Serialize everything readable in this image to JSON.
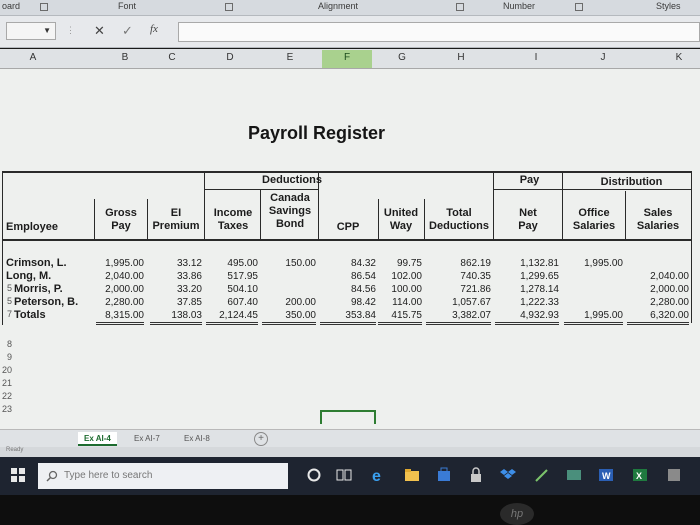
{
  "ribbon": {
    "clipboard_label": "oard",
    "font_label": "Font",
    "alignment_label": "Alignment",
    "number_label": "Number",
    "styles_label": "Styles"
  },
  "formula_bar": {
    "cancel_symbol": "✕",
    "enter_symbol": "✓",
    "fx_symbol": "fx",
    "formula_value": ""
  },
  "column_headers": [
    "A",
    "B",
    "C",
    "D",
    "E",
    "F",
    "G",
    "H",
    "I",
    "J",
    "K"
  ],
  "selected_column": "F",
  "row_numbers": [
    "8",
    "9",
    "20",
    "21",
    "22",
    "23"
  ],
  "sheet": {
    "title": "Payroll Register",
    "group_headers": {
      "deductions": "Deductions",
      "pay": "Pay",
      "distribution": "Distribution"
    },
    "headers": {
      "employee": "Employee",
      "gross_pay": [
        "Gross",
        "Pay"
      ],
      "ei_premium": [
        "EI",
        "Premium"
      ],
      "income_taxes": [
        "Income",
        "Taxes"
      ],
      "canada_savings_bond": [
        "Canada",
        "Savings",
        "Bond"
      ],
      "cpp": "CPP",
      "united_way": [
        "United",
        "Way"
      ],
      "total_deductions": [
        "Total",
        "Deductions"
      ],
      "net_pay": [
        "Net",
        "Pay"
      ],
      "office_salaries": [
        "Office",
        "Salaries"
      ],
      "sales_salaries": [
        "Sales",
        "Salaries"
      ]
    },
    "rows": [
      {
        "prefix": "",
        "employee": "Crimson, L.",
        "gross": "1,995.00",
        "ei": "33.12",
        "income_tax": "495.00",
        "csb": "150.00",
        "cpp": "84.32",
        "united_way": "99.75",
        "total_ded": "862.19",
        "net_pay": "1,132.81",
        "office": "1,995.00",
        "sales": ""
      },
      {
        "prefix": "",
        "employee": "Long, M.",
        "gross": "2,040.00",
        "ei": "33.86",
        "income_tax": "517.95",
        "csb": "",
        "cpp": "86.54",
        "united_way": "102.00",
        "total_ded": "740.35",
        "net_pay": "1,299.65",
        "office": "",
        "sales": "2,040.00"
      },
      {
        "prefix": "5",
        "employee": "Morris, P.",
        "gross": "2,000.00",
        "ei": "33.20",
        "income_tax": "504.10",
        "csb": "",
        "cpp": "84.56",
        "united_way": "100.00",
        "total_ded": "721.86",
        "net_pay": "1,278.14",
        "office": "",
        "sales": "2,000.00"
      },
      {
        "prefix": "5",
        "employee": "Peterson, B.",
        "gross": "2,280.00",
        "ei": "37.85",
        "income_tax": "607.40",
        "csb": "200.00",
        "cpp": "98.42",
        "united_way": "114.00",
        "total_ded": "1,057.67",
        "net_pay": "1,222.33",
        "office": "",
        "sales": "2,280.00"
      }
    ],
    "totals": {
      "prefix": "7",
      "label": "Totals",
      "gross": "8,315.00",
      "ei": "138.03",
      "income_tax": "2,124.45",
      "csb": "350.00",
      "cpp": "353.84",
      "united_way": "415.75",
      "total_ded": "3,382.07",
      "net_pay": "4,932.93",
      "office": "1,995.00",
      "sales": "6,320.00"
    }
  },
  "sheet_tabs": [
    "Ex AI-4",
    "Ex AI-7",
    "Ex AI-8"
  ],
  "add_sheet_symbol": "+",
  "status_text": "Ready",
  "taskbar": {
    "search_placeholder": "Type here to search"
  },
  "brand_logo": "hp",
  "colors": {
    "selected_column_bg": "#a9d18e",
    "taskbar_bg": "#1e2430",
    "sheet_bg": "#eef0ee"
  }
}
